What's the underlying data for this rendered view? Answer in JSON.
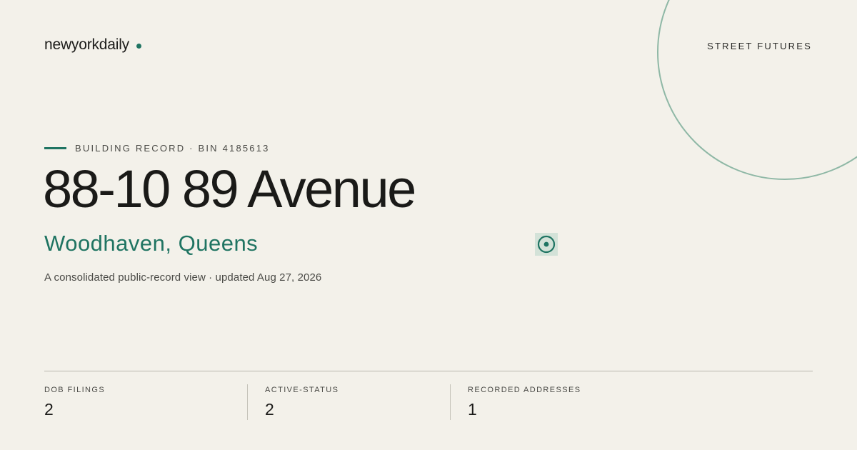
{
  "brand": {
    "name": "newyorkdaily",
    "accent_color": "#1f7462"
  },
  "section": {
    "label": "STREET FUTURES"
  },
  "record": {
    "eyebrow": "BUILDING RECORD · BIN 4185613",
    "address": "88-10 89 Avenue",
    "locality": "Woodhaven, Queens",
    "summary": "A consolidated public-record view · updated Aug 27, 2026",
    "pin_icon": "map-pin-target-icon"
  },
  "stats": [
    {
      "label": "DOB FILINGS",
      "value": "2"
    },
    {
      "label": "ACTIVE-STATUS",
      "value": "2"
    },
    {
      "label": "RECORDED ADDRESSES",
      "value": "1"
    }
  ],
  "colors": {
    "background": "#f3f1ea",
    "accent": "#1f7462",
    "decor_circle": "#8fb8a6",
    "pin_background": "#d3e2d8"
  }
}
